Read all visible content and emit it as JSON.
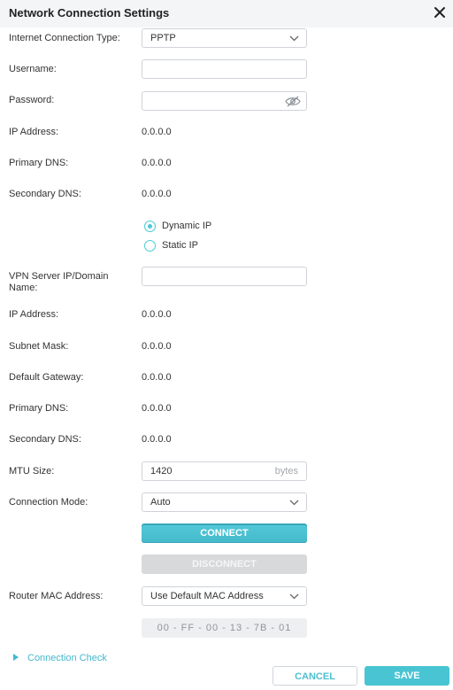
{
  "dialog": {
    "title": "Network Connection Settings",
    "close_icon": "close-icon"
  },
  "fields": {
    "connection_type": {
      "label": "Internet Connection Type:",
      "value": "PPTP"
    },
    "username": {
      "label": "Username:",
      "value": ""
    },
    "password": {
      "label": "Password:",
      "value": "",
      "icon": "eye-off-icon"
    },
    "ip_address_1": {
      "label": "IP Address:",
      "value": "0.0.0.0"
    },
    "primary_dns_1": {
      "label": "Primary DNS:",
      "value": "0.0.0.0"
    },
    "secondary_dns_1": {
      "label": "Secondary DNS:",
      "value": "0.0.0.0"
    },
    "ip_mode": {
      "options": [
        {
          "label": "Dynamic IP",
          "selected": true
        },
        {
          "label": "Static IP",
          "selected": false
        }
      ]
    },
    "vpn_server": {
      "label": "VPN Server IP/Domain Name:",
      "value": ""
    },
    "ip_address_2": {
      "label": "IP Address:",
      "value": "0.0.0.0"
    },
    "subnet_mask": {
      "label": "Subnet Mask:",
      "value": "0.0.0.0"
    },
    "default_gateway": {
      "label": "Default Gateway:",
      "value": "0.0.0.0"
    },
    "primary_dns_2": {
      "label": "Primary DNS:",
      "value": "0.0.0.0"
    },
    "secondary_dns_2": {
      "label": "Secondary DNS:",
      "value": "0.0.0.0"
    },
    "mtu": {
      "label": "MTU Size:",
      "value": "1420",
      "unit": "bytes"
    },
    "connection_mode": {
      "label": "Connection Mode:",
      "value": "Auto"
    },
    "router_mac": {
      "label": "Router MAC Address:",
      "value": "Use Default MAC Address",
      "mac": "00 - FF - 00 - 13 - 7B - 01"
    }
  },
  "buttons": {
    "connect": "CONNECT",
    "disconnect": "DISCONNECT",
    "cancel": "CANCEL",
    "save": "SAVE"
  },
  "links": {
    "connection_check": "Connection Check"
  },
  "colors": {
    "accent": "#4bc4d5",
    "disabled": "#d8d9db",
    "header_bg": "#f4f5f7"
  }
}
